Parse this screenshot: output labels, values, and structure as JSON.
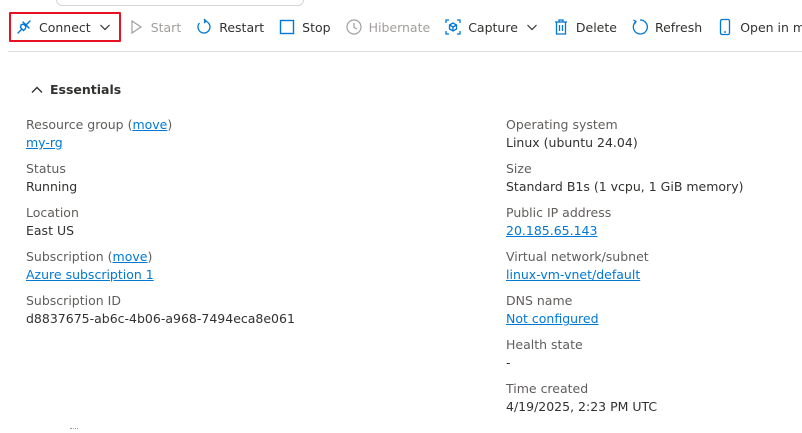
{
  "toolbar": {
    "connect_label": "Connect",
    "start_label": "Start",
    "restart_label": "Restart",
    "stop_label": "Stop",
    "hibernate_label": "Hibernate",
    "capture_label": "Capture",
    "delete_label": "Delete",
    "refresh_label": "Refresh",
    "open_mobile_label": "Open in mobil"
  },
  "essentials": {
    "title": "Essentials",
    "left": {
      "resource_group_label": "Resource group (",
      "resource_group_move": "move",
      "resource_group_close": ")",
      "resource_group_value": "my-rg",
      "status_label": "Status",
      "status_value": "Running",
      "location_label": "Location",
      "location_value": "East US",
      "subscription_label": "Subscription (",
      "subscription_move": "move",
      "subscription_close": ")",
      "subscription_value": "Azure subscription 1",
      "subscription_id_label": "Subscription ID",
      "subscription_id_value": "d8837675-ab6c-4b06-a968-7494eca8e061"
    },
    "right": {
      "os_label": "Operating system",
      "os_value": "Linux (ubuntu 24.04)",
      "size_label": "Size",
      "size_value": "Standard B1s (1 vcpu, 1 GiB memory)",
      "public_ip_label": "Public IP address",
      "public_ip_value": "20.185.65.143",
      "vnet_label": "Virtual network/subnet",
      "vnet_value": "linux-vm-vnet/default",
      "dns_label": "DNS name",
      "dns_value": "Not configured",
      "health_label": "Health state",
      "health_value": "-",
      "time_created_label": "Time created",
      "time_created_value": "4/19/2025, 2:23 PM UTC"
    }
  },
  "colors": {
    "link": "#0078d4",
    "highlight_border": "#e81123",
    "disabled_text": "#a19f9d",
    "text": "#323130"
  },
  "icons": {
    "connect": "plug-icon",
    "start": "play-icon",
    "restart": "restart-icon",
    "stop": "stop-icon",
    "hibernate": "hibernate-icon",
    "capture": "capture-icon",
    "delete": "trash-icon",
    "refresh": "refresh-icon",
    "open_mobile": "mobile-icon"
  }
}
